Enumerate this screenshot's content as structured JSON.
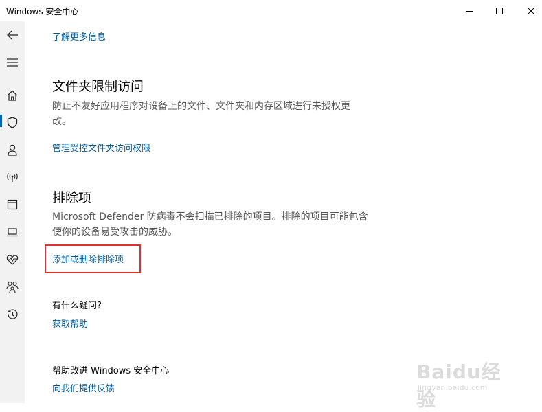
{
  "window": {
    "title": "Windows 安全中心",
    "controls": [
      "minimize",
      "maximize",
      "close"
    ]
  },
  "sidebar": {
    "items": [
      {
        "name": "back",
        "icon": "back-arrow-icon"
      },
      {
        "name": "menu",
        "icon": "hamburger-icon"
      },
      {
        "name": "home",
        "icon": "home-icon"
      },
      {
        "name": "virus-protection",
        "icon": "shield-icon",
        "selected": true
      },
      {
        "name": "account-protection",
        "icon": "person-icon"
      },
      {
        "name": "firewall",
        "icon": "antenna-icon"
      },
      {
        "name": "app-browser-control",
        "icon": "browser-window-icon"
      },
      {
        "name": "device-security",
        "icon": "laptop-icon"
      },
      {
        "name": "device-performance",
        "icon": "heart-pulse-icon"
      },
      {
        "name": "family-options",
        "icon": "family-icon"
      },
      {
        "name": "protection-history",
        "icon": "history-icon"
      }
    ],
    "accent": "#0063b1"
  },
  "content": {
    "learn_more_link": "了解更多信息",
    "cfa": {
      "title": "文件夹限制访问",
      "desc_line1": "防止不友好应用程序对设备上的文件、文件夹和内存区域进行未授权更",
      "desc_line2": "改。",
      "link": "管理受控文件夹访问权限"
    },
    "exclusions": {
      "title": "排除项",
      "desc_line1": "Microsoft Defender 防病毒不会扫描已排除的项目。排除的项目可能包含",
      "desc_line2": "使你的设备易受攻击的威胁。",
      "link": "添加或删除排除项"
    },
    "questions": {
      "title": "有什么疑问?",
      "link": "获取帮助"
    },
    "improve": {
      "title": "帮助改进 Windows 安全中心",
      "link": "向我们提供反馈"
    }
  },
  "watermark": {
    "logo": "Baidu经验",
    "url": "jingyan.baidu.com"
  },
  "colors": {
    "link": "#005a9e",
    "highlight_border": "#e03030",
    "sidebar_bg": "#f2f2f2"
  }
}
